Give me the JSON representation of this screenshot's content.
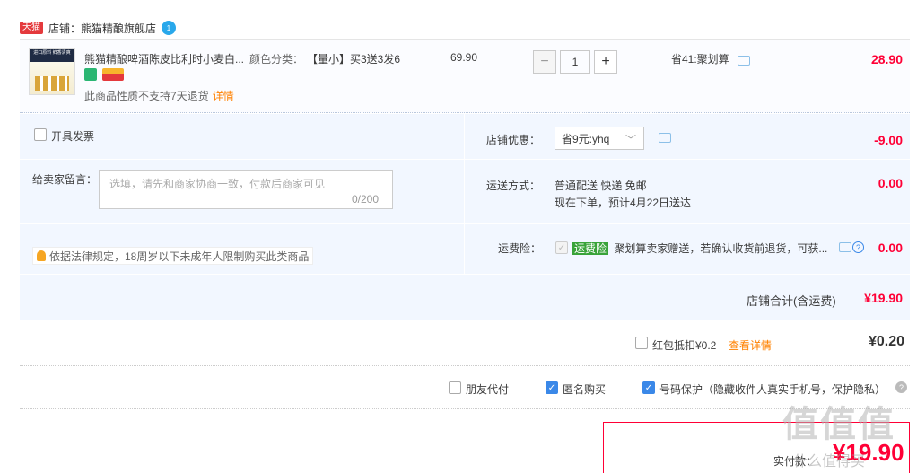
{
  "shop": {
    "badge": "天猫",
    "label": "店铺：",
    "name": "熊猫精酿旗舰店",
    "ww_badge": "1"
  },
  "item": {
    "title": "熊猫精酿啤酒陈皮比利时小麦白...",
    "sku_label": "颜色分类：",
    "sku_value": "【量小】买3送3发6",
    "notice": "此商品性质不支持7天退货",
    "notice_link": "详情",
    "price": "69.90",
    "qty_minus": "−",
    "qty": "1",
    "qty_plus": "+",
    "promo": "省41:聚划算",
    "subtotal": "28.90",
    "thumb_text": "进口原料 鲜香清爽"
  },
  "invoice": {
    "label": "开具发票"
  },
  "message": {
    "label": "给卖家留言：",
    "placeholder": "选填，请先和商家协商一致，付款后商家可见",
    "count": "0/200"
  },
  "law_notice": "依据法律规定，18周岁以下未成年人限制购买此类商品",
  "shop_discount": {
    "label": "店铺优惠：",
    "selected": "省9元:yhq",
    "amount": "-9.00"
  },
  "shipping": {
    "label": "运送方式：",
    "method": "普通配送 快递 免邮",
    "eta": "现在下单，预计4月22日送达",
    "amount": "0.00"
  },
  "insurance": {
    "label": "运费险：",
    "badge": "运费险",
    "desc": "聚划算卖家赠送，若确认收货前退货，可获...",
    "amount": "0.00"
  },
  "shop_total": {
    "label": "店铺合计(含运费)",
    "amount": "¥19.90"
  },
  "hongbao": {
    "label": "红包抵扣¥0.2",
    "link": "查看详情",
    "amount": "¥0.20"
  },
  "options": {
    "friend_pay": "朋友代付",
    "anonymous": "匿名购买",
    "number_protect": "号码保护（隐藏收件人真实手机号，保护隐私）"
  },
  "payment": {
    "label": "实付款：",
    "amount": "¥19.90"
  },
  "watermark": {
    "main": "值值值",
    "sub": "什么值得买"
  },
  "colors": {
    "accent_red": "#ff0036",
    "link_orange": "#ff8100",
    "check_blue": "#3a88e8",
    "panel_bg": "#f2f7ff"
  }
}
